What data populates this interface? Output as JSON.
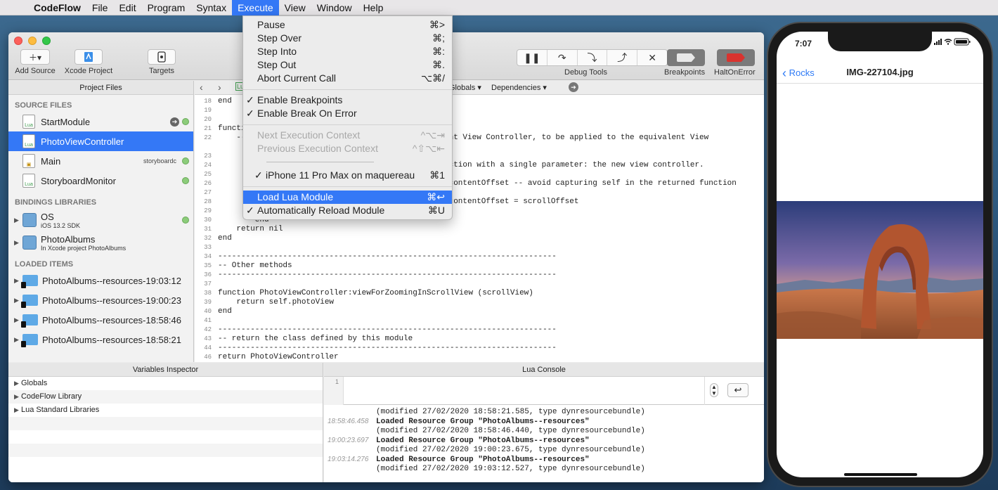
{
  "menubar": {
    "app_name": "CodeFlow",
    "items": [
      "File",
      "Edit",
      "Program",
      "Syntax",
      "Execute",
      "View",
      "Window",
      "Help"
    ]
  },
  "toolbar": {
    "add_source": "Add Source",
    "xcode_project": "Xcode Project",
    "targets": "Targets",
    "debug_tools": "Debug Tools",
    "breakpoints": "Breakpoints",
    "halt_on_error": "HaltOnError"
  },
  "sidebar": {
    "title": "Project Files",
    "source_files_header": "SOURCE FILES",
    "source_files": [
      {
        "name": "StartModule",
        "tag": ""
      },
      {
        "name": "PhotoViewController",
        "tag": ""
      },
      {
        "name": "Main",
        "tag": "storyboardc"
      },
      {
        "name": "StoryboardMonitor",
        "tag": ""
      }
    ],
    "bindings_header": "BINDINGS LIBRARIES",
    "bindings": [
      {
        "name": "OS",
        "sub": "iOS 13.2 SDK"
      },
      {
        "name": "PhotoAlbums",
        "sub": "In Xcode project PhotoAlbums"
      }
    ],
    "loaded_header": "LOADED ITEMS",
    "loaded": [
      "PhotoAlbums--resources-19:03:12",
      "PhotoAlbums--resources-19:00:23",
      "PhotoAlbums--resources-18:58:46",
      "PhotoAlbums--resources-18:58:21"
    ]
  },
  "editor": {
    "nav_badge": "Lu",
    "globals_popup": "Globals",
    "dependencies_popup": "Dependencies"
  },
  "code_lines": [
    {
      "n": "18",
      "t": "end"
    },
    {
      "n": "19",
      "t": ""
    },
    {
      "n": "20",
      "t": ""
    },
    {
      "n": "21",
      "t": "functi"
    },
    {
      "n": "22",
      "t": "    --"
    },
    {
      "n": "23",
      "t": ""
    },
    {
      "n": "24",
      "t": ""
    },
    {
      "n": "25",
      "t": ""
    },
    {
      "n": "26",
      "t": ""
    },
    {
      "n": "27",
      "t": ""
    },
    {
      "n": "28",
      "t": ""
    },
    {
      "n": "29",
      "t": ""
    },
    {
      "n": "30",
      "t": "        end"
    },
    {
      "n": "31",
      "t": "    return nil"
    },
    {
      "n": "32",
      "t": "end"
    },
    {
      "n": "33",
      "t": ""
    },
    {
      "n": "34",
      "t": "-------------------------------------------------------------------------"
    },
    {
      "n": "35",
      "t": "-- Other methods"
    },
    {
      "n": "36",
      "t": "-------------------------------------------------------------------------"
    },
    {
      "n": "37",
      "t": ""
    },
    {
      "n": "38",
      "t": "function PhotoViewController:viewForZoomingInScrollView (scrollView)"
    },
    {
      "n": "39",
      "t": "    return self.photoView"
    },
    {
      "n": "40",
      "t": "end"
    },
    {
      "n": "41",
      "t": ""
    },
    {
      "n": "42",
      "t": "-------------------------------------------------------------------------"
    },
    {
      "n": "43",
      "t": "-- return the class defined by this module"
    },
    {
      "n": "44",
      "t": "-------------------------------------------------------------------------"
    },
    {
      "n": "45",
      "t": ""
    },
    {
      "n": "46",
      "t": "return PhotoViewController"
    }
  ],
  "code_fragments": {
    "line22_right": "ent View Controller, to be applied to the equivalent View",
    "line24_right": "nction with a single parameter: the new view controller.",
    "line26_right": ".contentOffset -- avoid capturing self in the returned function",
    "line28_right": ".contentOffset = scrollOffset"
  },
  "execute_menu": {
    "items": [
      {
        "label": "Pause",
        "shortcut": "⌘>",
        "check": "",
        "state": "normal"
      },
      {
        "label": "Step Over",
        "shortcut": "⌘;",
        "check": "",
        "state": "normal"
      },
      {
        "label": "Step Into",
        "shortcut": "⌘:",
        "check": "",
        "state": "normal"
      },
      {
        "label": "Step Out",
        "shortcut": "⌘.",
        "check": "",
        "state": "normal"
      },
      {
        "label": "Abort Current Call",
        "shortcut": "⌥⌘/",
        "check": "",
        "state": "normal"
      },
      {
        "label": "Enable Breakpoints",
        "shortcut": "",
        "check": "✓",
        "state": "normal"
      },
      {
        "label": "Enable Break On Error",
        "shortcut": "",
        "check": "✓",
        "state": "normal"
      },
      {
        "label": "Next Execution Context",
        "shortcut": "^⌥⇥",
        "check": "",
        "state": "disabled"
      },
      {
        "label": "Previous Execution Context",
        "shortcut": "^⇧⌥⇤",
        "check": "",
        "state": "disabled"
      },
      {
        "label": "iPhone 11 Pro Max on maquereau",
        "shortcut": "⌘1",
        "check": "✓",
        "state": "normal"
      },
      {
        "label": "Load Lua Module",
        "shortcut": "⌘↩",
        "check": "",
        "state": "highlighted"
      },
      {
        "label": "Automatically Reload Module",
        "shortcut": "⌘U",
        "check": "✓",
        "state": "normal"
      }
    ]
  },
  "variables_inspector": {
    "title": "Variables Inspector",
    "rows": [
      "Globals",
      "CodeFlow Library",
      "Lua Standard Libraries"
    ]
  },
  "lua_console": {
    "title": "Lua Console",
    "line_number": "1",
    "log": [
      {
        "ts": "",
        "bold": "",
        "text": "(modified 27/02/2020 18:58:21.585, type dynresourcebundle)"
      },
      {
        "ts": "18:58:46.458",
        "bold": "Loaded Resource Group \"PhotoAlbums--resources\"",
        "text": ""
      },
      {
        "ts": "",
        "bold": "",
        "text": "(modified 27/02/2020 18:58:46.440, type dynresourcebundle)"
      },
      {
        "ts": "19:00:23.697",
        "bold": "Loaded Resource Group \"PhotoAlbums--resources\"",
        "text": ""
      },
      {
        "ts": "",
        "bold": "",
        "text": "(modified 27/02/2020 19:00:23.675, type dynresourcebundle)"
      },
      {
        "ts": "19:03:14.276",
        "bold": "Loaded Resource Group \"PhotoAlbums--resources\"",
        "text": ""
      },
      {
        "ts": "",
        "bold": "",
        "text": "(modified 27/02/2020 19:03:12.527, type dynresourcebundle)"
      }
    ]
  },
  "phone": {
    "time": "7:07",
    "back_label": "Rocks",
    "title": "IMG-227104.jpg"
  },
  "colors": {
    "accent": "#3478f6",
    "breakpoint_active": "#6b6b6b",
    "halt_on_error": "#d9332f"
  }
}
